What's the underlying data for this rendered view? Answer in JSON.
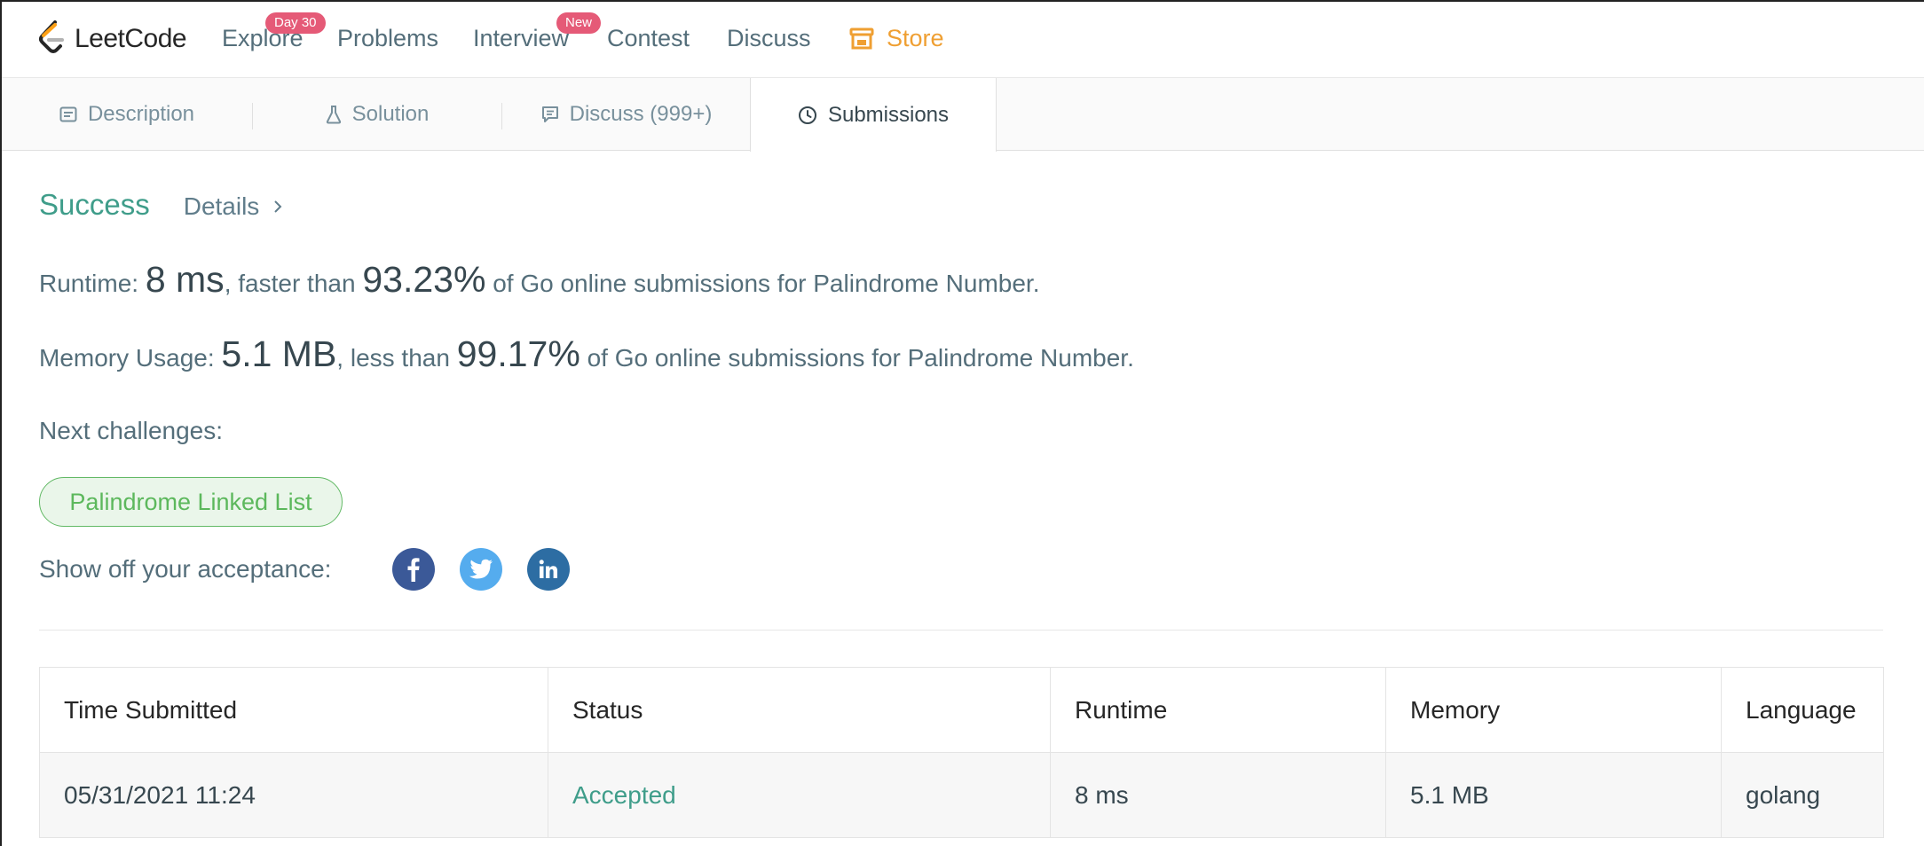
{
  "nav": {
    "brand": "LeetCode",
    "items": [
      {
        "label": "Explore",
        "badge": "Day 30"
      },
      {
        "label": "Problems"
      },
      {
        "label": "Interview",
        "badge": "New"
      },
      {
        "label": "Contest"
      },
      {
        "label": "Discuss"
      },
      {
        "label": "Store",
        "icon": "store-icon",
        "color": "#ef9f32"
      }
    ]
  },
  "tabs": [
    {
      "label": "Description",
      "icon": "description-icon"
    },
    {
      "label": "Solution",
      "icon": "flask-icon"
    },
    {
      "label": "Discuss (999+)",
      "icon": "comment-icon"
    },
    {
      "label": "Submissions",
      "icon": "clock-icon",
      "active": true
    }
  ],
  "result": {
    "status": "Success",
    "details_label": "Details",
    "runtime": {
      "label": "Runtime:",
      "value": "8 ms",
      "mid": ", faster than",
      "percent": "93.23%",
      "suffix": "of Go online submissions for Palindrome Number."
    },
    "memory": {
      "label": "Memory Usage:",
      "value": "5.1 MB",
      "mid": ", less than",
      "percent": "99.17%",
      "suffix": "of Go online submissions for Palindrome Number."
    },
    "next_label": "Next challenges:",
    "next_challenges": [
      "Palindrome Linked List"
    ],
    "share_label": "Show off your acceptance:",
    "share": [
      {
        "name": "facebook",
        "color": "#3b5998"
      },
      {
        "name": "twitter",
        "color": "#55acee"
      },
      {
        "name": "linkedin",
        "color": "#2d6da3"
      }
    ]
  },
  "table": {
    "columns": [
      "Time Submitted",
      "Status",
      "Runtime",
      "Memory",
      "Language"
    ],
    "rows": [
      [
        "05/31/2021 11:24",
        "Accepted",
        "8 ms",
        "5.1 MB",
        "golang"
      ]
    ]
  },
  "colors": {
    "success": "#3f9d8a",
    "chip": "#5cb85c",
    "badge": "#e55a77",
    "store": "#ef9f32"
  }
}
